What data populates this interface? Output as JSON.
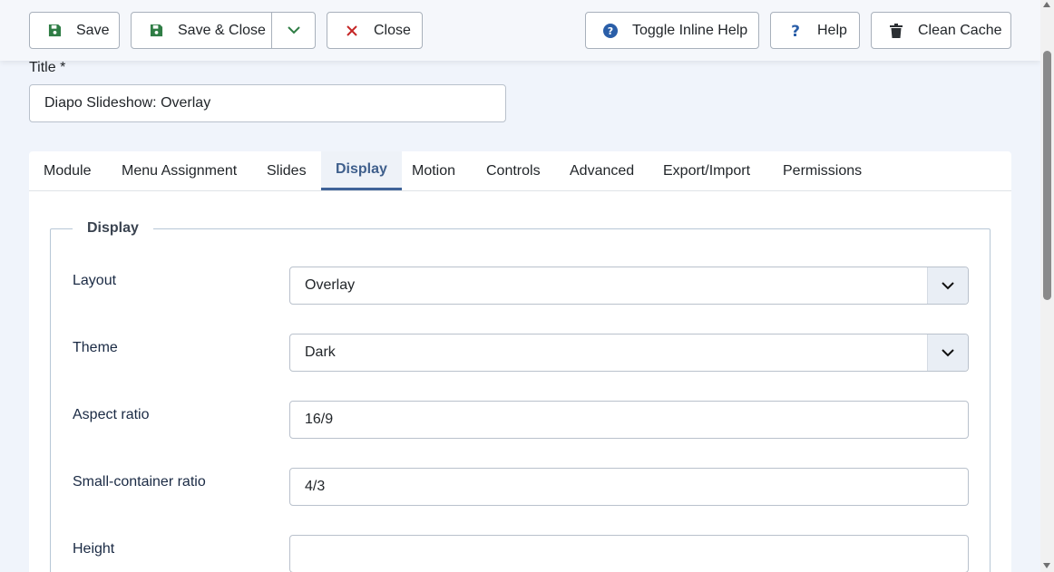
{
  "toolbar": {
    "save_label": "Save",
    "save_close_label": "Save & Close",
    "close_label": "Close",
    "inline_help_label": "Toggle Inline Help",
    "help_label": "Help",
    "clean_cache_label": "Clean Cache"
  },
  "title_field": {
    "label": "Title *",
    "value": "Diapo Slideshow: Overlay"
  },
  "tabs": [
    {
      "label": "Module"
    },
    {
      "label": "Menu Assignment"
    },
    {
      "label": "Slides"
    },
    {
      "label": "Display",
      "active": true
    },
    {
      "label": "Motion"
    },
    {
      "label": "Controls"
    },
    {
      "label": "Advanced"
    },
    {
      "label": "Export/Import"
    },
    {
      "label": "Permissions"
    }
  ],
  "display": {
    "legend": "Display",
    "fields": [
      {
        "label": "Layout",
        "value": "Overlay",
        "type": "select"
      },
      {
        "label": "Theme",
        "value": "Dark",
        "type": "select"
      },
      {
        "label": "Aspect ratio",
        "value": "16/9",
        "type": "text"
      },
      {
        "label": "Small-container ratio",
        "value": "4/3",
        "type": "text"
      },
      {
        "label": "Height",
        "value": "",
        "type": "text"
      }
    ]
  },
  "colors": {
    "save_icon": "#2f7d45",
    "close_icon": "#c52727",
    "help_icon": "#2a5ea8",
    "active_tab": "#3f5f8c"
  }
}
